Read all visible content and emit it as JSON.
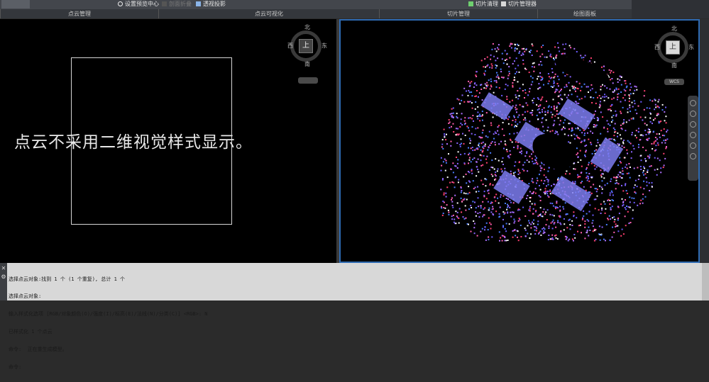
{
  "ribbon": {
    "buttons": [
      {
        "id": "cloud-manage",
        "label": ""
      },
      {
        "id": "preview-center",
        "label": "设置预览中心",
        "icon": "gear-icon"
      },
      {
        "id": "disabled-tool",
        "label": "剖面折叠",
        "disabled": true
      },
      {
        "id": "perspective",
        "label": "透视投影",
        "icon": "projection-icon"
      },
      {
        "id": "slice-clean",
        "label": "切片清理",
        "icon": "slice-clean-icon"
      },
      {
        "id": "slice-manager",
        "label": "切片管理器",
        "icon": "slice-manager-icon"
      }
    ],
    "panels": [
      "点云管理",
      "点云可视化",
      "切片管理",
      "绘图面板"
    ]
  },
  "left_viewport": {
    "message": "点云不采用二维视觉样式显示。",
    "viewcube": {
      "north": "北",
      "south": "南",
      "east": "东",
      "west": "西",
      "face": "上"
    }
  },
  "right_viewport": {
    "viewcube": {
      "north": "北",
      "south": "南",
      "east": "东",
      "west": "西",
      "face": "上",
      "wcs": "WCS"
    },
    "pointcloud_colors": [
      "#6c5cff",
      "#8a63ff",
      "#ff5fb0",
      "#ff4070",
      "#4a7cff",
      "#b070ff",
      "#ffffff"
    ]
  },
  "command": {
    "lines": [
      "选择点云对象:找到 1 个 (1 个重复), 总计 1 个",
      "选择点云对象:",
      "输入样式化选项 [RGB/对象颜色(O)/强度(I)/标高(E)/法线(N)/分类(C)] <RGB>: N",
      "已样式化 1 个点云",
      "命令:  正在重生成模型。",
      "命令:"
    ]
  }
}
